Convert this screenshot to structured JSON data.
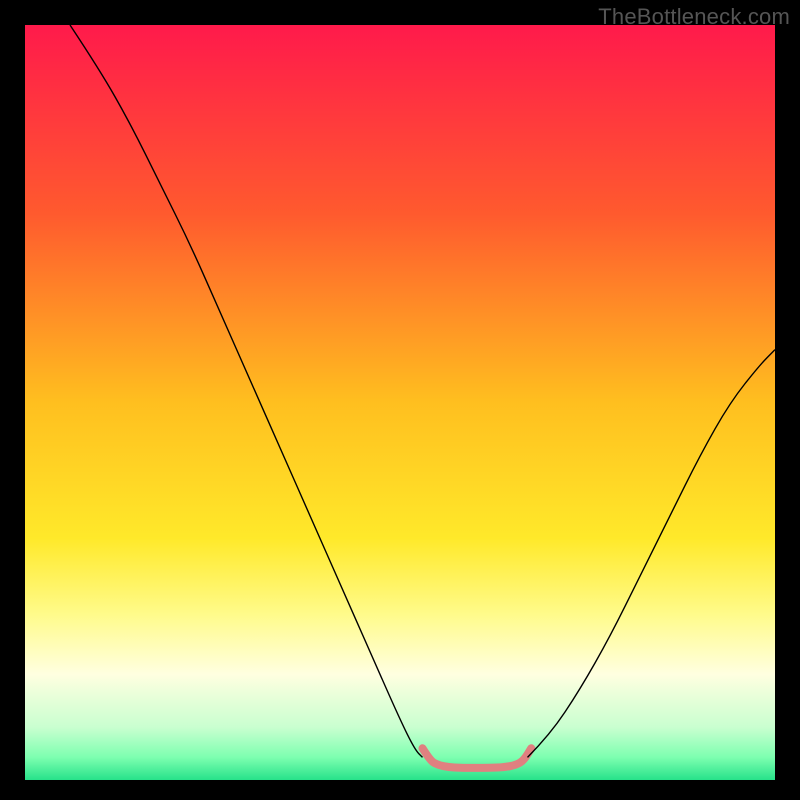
{
  "watermark": "TheBottleneck.com",
  "chart_data": {
    "type": "line",
    "title": "",
    "xlabel": "",
    "ylabel": "",
    "xlim": [
      0,
      100
    ],
    "ylim": [
      0,
      100
    ],
    "grid": false,
    "legend": false,
    "background_gradient": {
      "stops": [
        {
          "offset": 0.0,
          "color": "#ff1a4b"
        },
        {
          "offset": 0.25,
          "color": "#ff5a2e"
        },
        {
          "offset": 0.5,
          "color": "#ffbf1f"
        },
        {
          "offset": 0.68,
          "color": "#ffe92a"
        },
        {
          "offset": 0.78,
          "color": "#fffb8a"
        },
        {
          "offset": 0.86,
          "color": "#ffffe0"
        },
        {
          "offset": 0.93,
          "color": "#c9ffd0"
        },
        {
          "offset": 0.97,
          "color": "#7dffb0"
        },
        {
          "offset": 1.0,
          "color": "#27e28a"
        }
      ]
    },
    "series": [
      {
        "name": "black-curve-left",
        "color": "#000000",
        "width": 1.4,
        "x": [
          6,
          10,
          14,
          18,
          22,
          26,
          30,
          34,
          38,
          42,
          46,
          50,
          52,
          53
        ],
        "y": [
          100,
          94,
          87,
          79,
          71,
          62,
          53,
          44,
          35,
          26,
          17,
          8,
          4,
          3
        ]
      },
      {
        "name": "salmon-flat-bottom",
        "color": "#e08080",
        "width": 8,
        "linecap": "round",
        "x": [
          53.0,
          54.0,
          55.0,
          56.5,
          58.0,
          60.0,
          62.0,
          64.0,
          65.5,
          66.5,
          67.5
        ],
        "y": [
          4.2,
          2.6,
          2.0,
          1.7,
          1.6,
          1.6,
          1.6,
          1.7,
          2.0,
          2.6,
          4.2
        ]
      },
      {
        "name": "black-curve-right",
        "color": "#000000",
        "width": 1.4,
        "x": [
          67,
          70,
          74,
          78,
          82,
          86,
          90,
          94,
          98,
          100
        ],
        "y": [
          3,
          6,
          12,
          19,
          27,
          35,
          43,
          50,
          55,
          57
        ]
      }
    ]
  }
}
